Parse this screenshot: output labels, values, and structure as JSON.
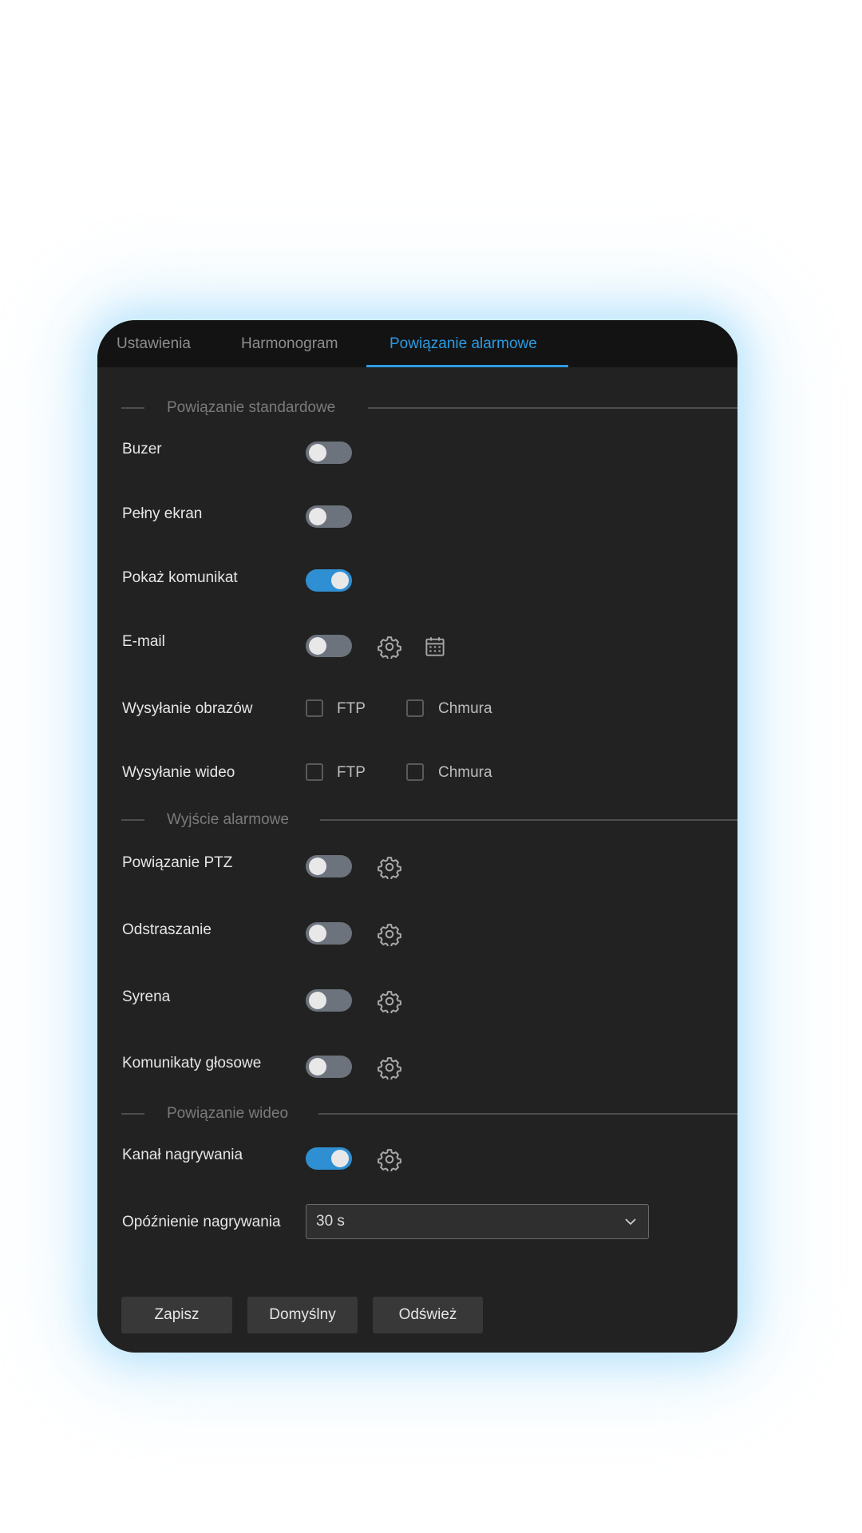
{
  "tabs": {
    "settings": "Ustawienia",
    "schedule": "Harmonogram",
    "alarm_linkage": "Powiązanie alarmowe"
  },
  "sections": {
    "standard": "Powiązanie standardowe",
    "alarm_output": "Wyjście alarmowe",
    "video": "Powiązanie wideo"
  },
  "rows": {
    "buzzer": {
      "label": "Buzer",
      "enabled": false
    },
    "fullscreen": {
      "label": "Pełny ekran",
      "enabled": false
    },
    "show_message": {
      "label": "Pokaż komunikat",
      "enabled": true
    },
    "email": {
      "label": "E-mail",
      "enabled": false
    },
    "image_upload": {
      "label": "Wysyłanie obrazów",
      "ftp": "FTP",
      "cloud": "Chmura"
    },
    "video_upload": {
      "label": "Wysyłanie wideo",
      "ftp": "FTP",
      "cloud": "Chmura"
    },
    "ptz": {
      "label": "Powiązanie PTZ",
      "enabled": false
    },
    "deterrence": {
      "label": "Odstraszanie",
      "enabled": false
    },
    "siren": {
      "label": "Syrena",
      "enabled": false
    },
    "voice_prompts": {
      "label": "Komunikaty głosowe",
      "enabled": false
    },
    "record_channel": {
      "label": "Kanał nagrywania",
      "enabled": true
    },
    "record_delay": {
      "label": "Opóźnienie nagrywania",
      "value": "30 s"
    }
  },
  "buttons": {
    "save": "Zapisz",
    "default": "Domyślny",
    "refresh": "Odśwież"
  },
  "icons": {
    "gear": "gear-icon",
    "calendar": "calendar-icon",
    "chevron": "chevron-down-icon"
  },
  "colors": {
    "accent": "#2b9be2",
    "toggle_on": "#2f8fd3",
    "toggle_off": "#6c737c",
    "panel_bg": "#222222",
    "tabbar_bg": "#131313"
  }
}
